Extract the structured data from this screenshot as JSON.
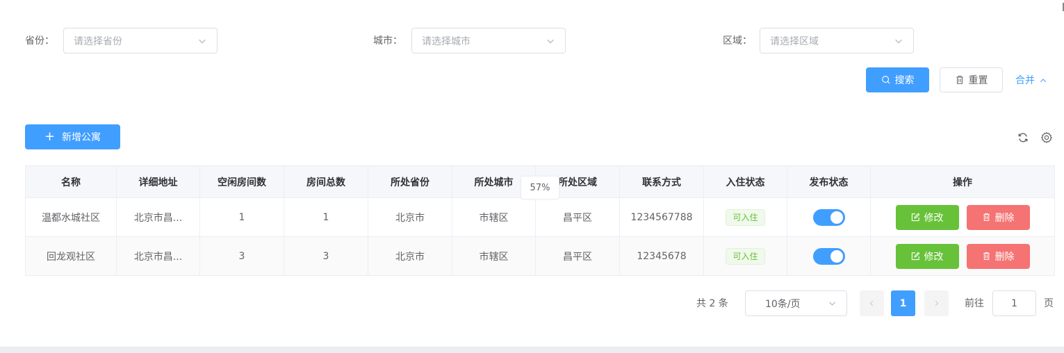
{
  "filters": [
    {
      "label": "省份：",
      "placeholder": "请选择省份"
    },
    {
      "label": "城市：",
      "placeholder": "请选择城市"
    },
    {
      "label": "区域：",
      "placeholder": "请选择区域"
    }
  ],
  "actions": {
    "search_label": "搜索",
    "reset_label": "重置",
    "collapse_label": "合并"
  },
  "toolbar": {
    "add_label": "新增公寓",
    "refresh_icon": "refresh-icon",
    "settings_icon": "gear-icon"
  },
  "table": {
    "columns": [
      "名称",
      "详细地址",
      "空闲房间数",
      "房间总数",
      "所处省份",
      "所处城市",
      "所处区域",
      "联系方式",
      "入住状态",
      "发布状态",
      "操作"
    ],
    "rows": [
      {
        "name": "温都水城社区",
        "address": "北京市昌...",
        "free_rooms": "1",
        "total_rooms": "1",
        "province": "北京市",
        "city": "市辖区",
        "district": "昌平区",
        "contact": "1234567788",
        "checkin_status": "可入住",
        "published": true,
        "edit_label": "修改",
        "delete_label": "删除"
      },
      {
        "name": "回龙观社区",
        "address": "北京市昌...",
        "free_rooms": "3",
        "total_rooms": "3",
        "province": "北京市",
        "city": "市辖区",
        "district": "昌平区",
        "contact": "12345678",
        "checkin_status": "可入住",
        "published": true,
        "edit_label": "修改",
        "delete_label": "删除"
      }
    ]
  },
  "overlay": {
    "zoom_percent": "57%"
  },
  "pagination": {
    "total_text": "共 2 条",
    "page_size": "10条/页",
    "current_page": "1",
    "goto_label": "前往",
    "goto_value": "1",
    "page_unit": "页"
  },
  "colors": {
    "primary": "#409eff",
    "success": "#67c23a",
    "danger": "#f56c6c"
  }
}
